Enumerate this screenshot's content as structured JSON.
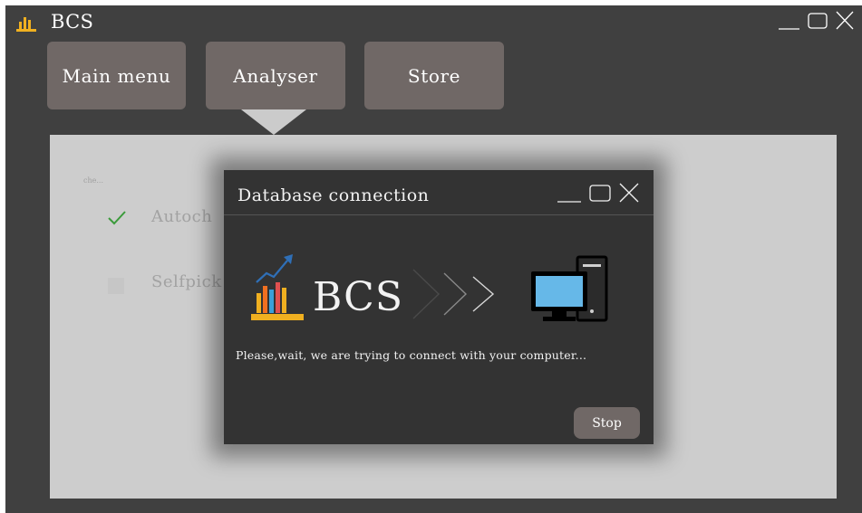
{
  "window": {
    "title": "BCS",
    "logo_icon": "bar-chart-icon",
    "controls": [
      "minimize-icon",
      "maximize-icon",
      "close-icon"
    ]
  },
  "tabs": [
    {
      "label": "Main menu"
    },
    {
      "label": "Analyser"
    },
    {
      "label": "Store"
    }
  ],
  "active_tab": "Analyser",
  "panel": {
    "caption": "che...",
    "options": [
      {
        "label": "Autoch",
        "checked": true
      },
      {
        "label": "Selfpick",
        "checked": false
      }
    ]
  },
  "dialog": {
    "title": "Database connection",
    "brand": "BCS",
    "message": "Please,wait, we are trying to connect with your computer...",
    "stop_label": "Stop"
  },
  "colors": {
    "window_bg": "#404040",
    "panel_bg": "#cdcdcd",
    "dialog_bg": "#333333",
    "button_bg": "#706866",
    "check_green": "#3b9b3b",
    "logo_orange": "#f0b020",
    "screen_blue": "#66b8e8"
  }
}
